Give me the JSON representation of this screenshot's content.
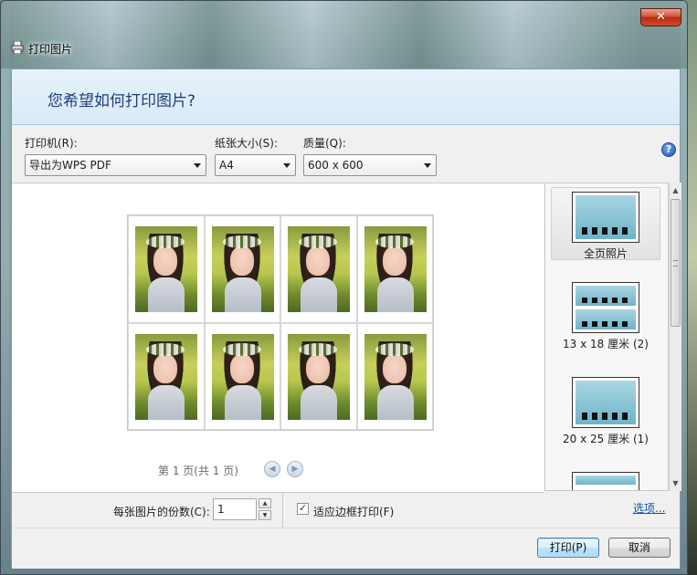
{
  "window": {
    "title": "打印图片",
    "close_label": "✕"
  },
  "header": {
    "question": "您希望如何打印图片?"
  },
  "settings": {
    "printer_label": "打印机(R):",
    "printer_value": "导出为WPS PDF",
    "paper_label": "纸张大小(S):",
    "paper_value": "A4",
    "quality_label": "质量(Q):",
    "quality_value": "600 x 600",
    "help_label": "?"
  },
  "preview": {
    "photo_count": 8,
    "page_text": "第 1 页(共 1 页)",
    "prev_label": "◀",
    "next_label": "▶"
  },
  "layouts": [
    {
      "caption": "全页照片",
      "selected": true
    },
    {
      "caption": "13 x 18 厘米 (2)",
      "selected": false
    },
    {
      "caption": "20 x 25 厘米 (1)",
      "selected": false
    }
  ],
  "bottom": {
    "copies_label": "每张图片的份数(C):",
    "copies_value": "1",
    "fit_label": "适应边框打印(F)",
    "fit_checked": true,
    "options_link": "选项..."
  },
  "footer": {
    "print_label": "打印(P)",
    "cancel_label": "取消"
  },
  "colors": {
    "header_title": "#1e3d7b",
    "link": "#0a53b5",
    "close": "#c7381d"
  }
}
